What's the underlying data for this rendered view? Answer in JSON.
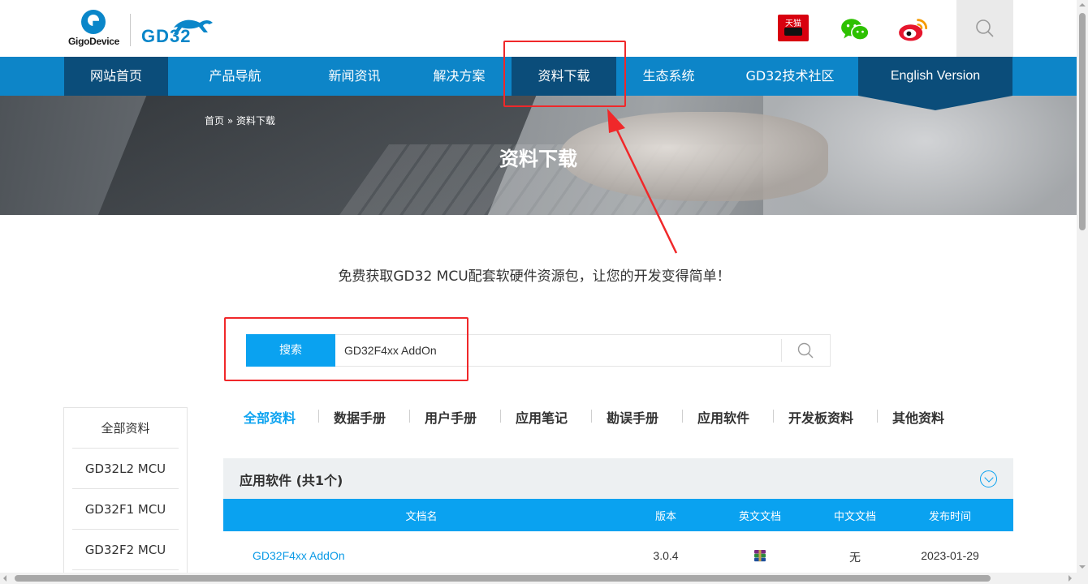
{
  "header": {
    "logo_giga": "GigoDevice",
    "logo_gd": "GD32",
    "tmall_label": "天猫",
    "icons": [
      "tmall-icon",
      "wechat-icon",
      "weibo-icon",
      "search-icon"
    ]
  },
  "nav": {
    "items": [
      "网站首页",
      "产品导航",
      "新闻资讯",
      "解决方案",
      "资料下载",
      "生态系统",
      "GD32技术社区",
      "English Version"
    ],
    "active": "资料下载"
  },
  "breadcrumb": {
    "home": "首页",
    "sep": "»",
    "current": "资料下载"
  },
  "banner": {
    "title": "资料下载"
  },
  "tagline": "免费获取GD32 MCU配套软硬件资源包，让您的开发变得简单！",
  "search": {
    "button_label": "搜索",
    "value": "GD32F4xx AddOn"
  },
  "sidebar": {
    "items": [
      "全部资料",
      "GD32L2  MCU",
      "GD32F1  MCU",
      "GD32F2  MCU"
    ]
  },
  "tabs": {
    "items": [
      "全部资料",
      "数据手册",
      "用户手册",
      "应用笔记",
      "勘误手册",
      "应用软件",
      "开发板资料",
      "其他资料"
    ],
    "active": "全部资料"
  },
  "section": {
    "title": "应用软件 (共1个)",
    "columns": [
      "文档名",
      "版本",
      "英文文档",
      "中文文档",
      "发布时间"
    ],
    "rows": [
      {
        "name": "GD32F4xx AddOn",
        "version": "3.0.4",
        "en_doc": "rar-file-icon",
        "cn_doc": "无",
        "date": "2023-01-29"
      }
    ]
  },
  "colors": {
    "nav": "#0d85c8",
    "nav_dark": "#0b4d7a",
    "accent": "#0aa2f0",
    "annotation": "#f0282a"
  }
}
